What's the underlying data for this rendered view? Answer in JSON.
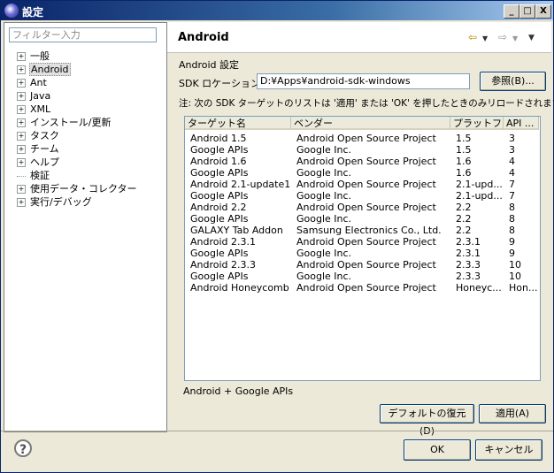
{
  "window": {
    "title": "設定",
    "controls": [
      "_",
      "□",
      "X"
    ]
  },
  "filter": {
    "placeholder": "フィルター入力"
  },
  "tree": [
    {
      "label": "一般",
      "expandable": true
    },
    {
      "label": "Android",
      "expandable": true,
      "selected": true
    },
    {
      "label": "Ant",
      "expandable": true
    },
    {
      "label": "Java",
      "expandable": true
    },
    {
      "label": "XML",
      "expandable": true
    },
    {
      "label": "インストール/更新",
      "expandable": true
    },
    {
      "label": "タスク",
      "expandable": true
    },
    {
      "label": "チーム",
      "expandable": true
    },
    {
      "label": "ヘルプ",
      "expandable": true
    },
    {
      "label": "検証",
      "expandable": false
    },
    {
      "label": "使用データ・コレクター",
      "expandable": true
    },
    {
      "label": "実行/デバッグ",
      "expandable": true
    }
  ],
  "page": {
    "title": "Android",
    "section_label": "Android 設定",
    "sdk_label": "SDK ロケーション:",
    "sdk_value": "D:¥Apps¥android-sdk-windows",
    "browse_label": "参照(B)...",
    "note": "注: 次の SDK ターゲットのリストは '適用' または 'OK' を押したときのみリロードされます。",
    "columns": [
      "ターゲット名",
      "ベンダー",
      "プラットフ...",
      "API ..."
    ],
    "rows": [
      [
        "Android 1.5",
        "Android Open Source Project",
        "1.5",
        "3"
      ],
      [
        "Google APIs",
        "Google Inc.",
        "1.5",
        "3"
      ],
      [
        "Android 1.6",
        "Android Open Source Project",
        "1.6",
        "4"
      ],
      [
        "Google APIs",
        "Google Inc.",
        "1.6",
        "4"
      ],
      [
        "Android 2.1-update1",
        "Android Open Source Project",
        "2.1-upd...",
        "7"
      ],
      [
        "Google APIs",
        "Google Inc.",
        "2.1-upd...",
        "7"
      ],
      [
        "Android 2.2",
        "Android Open Source Project",
        "2.2",
        "8"
      ],
      [
        "Google APIs",
        "Google Inc.",
        "2.2",
        "8"
      ],
      [
        "GALAXY Tab Addon",
        "Samsung Electronics Co., Ltd.",
        "2.2",
        "8"
      ],
      [
        "Android 2.3.1",
        "Android Open Source Project",
        "2.3.1",
        "9"
      ],
      [
        "Google APIs",
        "Google Inc.",
        "2.3.1",
        "9"
      ],
      [
        "Android 2.3.3",
        "Android Open Source Project",
        "2.3.3",
        "10"
      ],
      [
        "Google APIs",
        "Google Inc.",
        "2.3.3",
        "10"
      ],
      [
        "Android Honeycomb ...",
        "Android Open Source Project",
        "Honeyc...",
        "Hon..."
      ]
    ],
    "selected_target": "Android + Google APIs",
    "restore_label": "デフォルトの復元(D)",
    "apply_label": "適用(A)"
  },
  "footer": {
    "help": "?",
    "ok_label": "OK",
    "cancel_label": "キャンセル"
  }
}
